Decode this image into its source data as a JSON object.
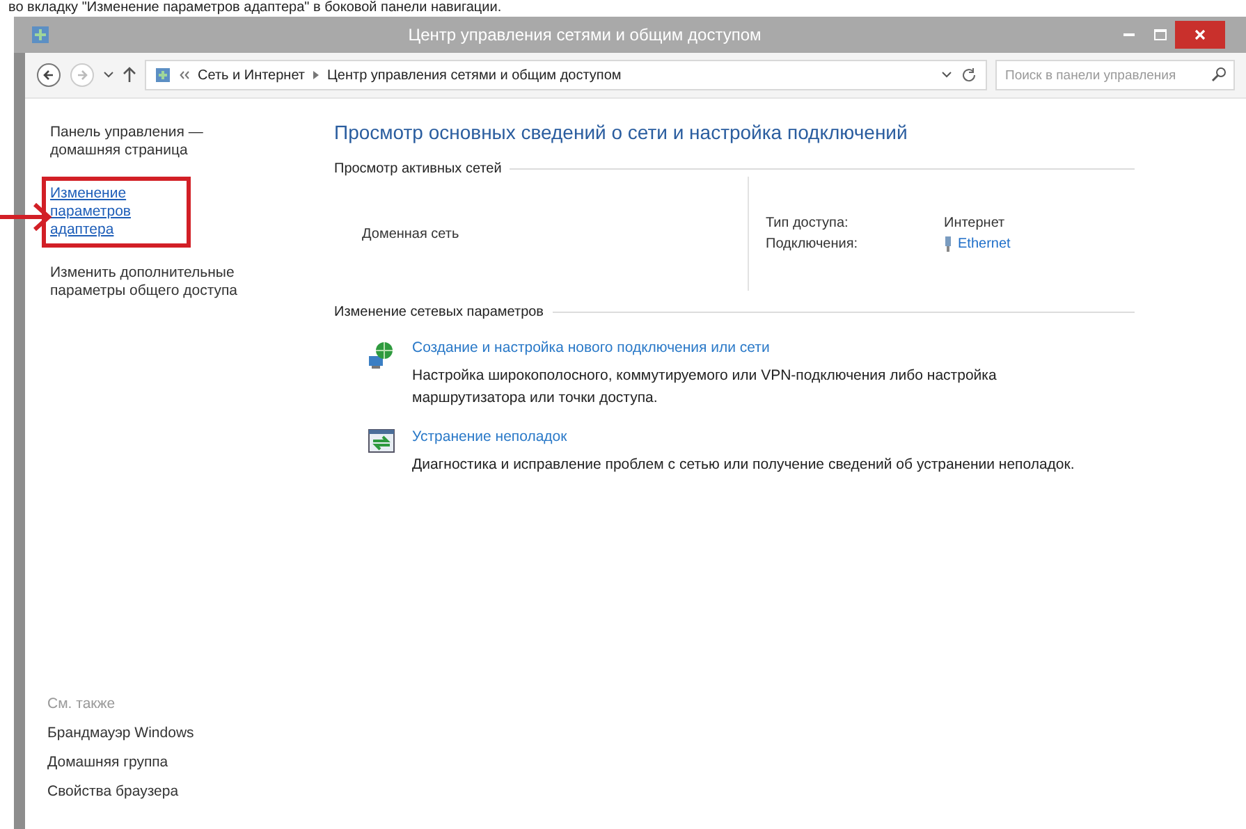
{
  "caption": "во вкладку \"Изменение параметров адаптера\" в боковой панели навигации.",
  "window": {
    "title": "Центр управления сетями и общим доступом"
  },
  "address_bar": {
    "path": [
      "Сеть и Интернет",
      "Центр управления сетями и общим доступом"
    ],
    "search": {
      "placeholder": "Поиск в панели управления"
    }
  },
  "sidebar": {
    "items": [
      {
        "label": "Панель управления — домашняя страница",
        "kind": "text",
        "highlighted": false
      },
      {
        "label": "Изменение параметров адаптера",
        "kind": "link",
        "highlighted": true
      },
      {
        "label": "Изменить дополнительные параметры общего доступа",
        "kind": "text",
        "highlighted": false
      }
    ],
    "see_also": {
      "title": "См. также",
      "items": [
        "Брандмауэр Windows",
        "Домашняя группа",
        "Свойства браузера"
      ]
    }
  },
  "main": {
    "heading": "Просмотр основных сведений о сети и настройка подключений",
    "active_networks": {
      "title": "Просмотр активных сетей",
      "network_name": "Доменная сеть",
      "access_type_label": "Тип доступа:",
      "access_type": "Интернет",
      "connections_label": "Подключения:",
      "connection": "Ethernet"
    },
    "change_settings": {
      "title": "Изменение сетевых параметров",
      "tasks": [
        {
          "kind": "setup",
          "link": "Создание и настройка нового подключения или сети",
          "description": "Настройка широкополосного, коммутируемого или VPN-подключения либо настройка маршрутизатора или точки доступа."
        },
        {
          "kind": "troubleshoot",
          "link": "Устранение неполадок",
          "description": "Диагностика и исправление проблем с сетью или получение сведений об устранении неполадок."
        }
      ]
    }
  }
}
